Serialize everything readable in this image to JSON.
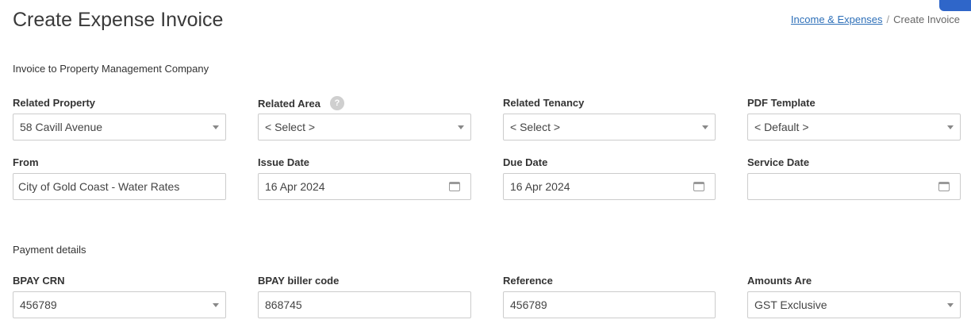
{
  "header": {
    "title": "Create Expense Invoice",
    "breadcrumb": {
      "link": "Income & Expenses",
      "separator": "/",
      "current": "Create Invoice"
    }
  },
  "sections": {
    "invoice_to": "Invoice to Property Management Company",
    "payment": "Payment details"
  },
  "fields": {
    "related_property": {
      "label": "Related Property",
      "value": "58 Cavill Avenue"
    },
    "related_area": {
      "label": "Related Area",
      "value": "< Select >",
      "help": "?"
    },
    "related_tenancy": {
      "label": "Related Tenancy",
      "value": "< Select >"
    },
    "pdf_template": {
      "label": "PDF Template",
      "value": "< Default >"
    },
    "from": {
      "label": "From",
      "value": "City of Gold Coast - Water Rates"
    },
    "issue_date": {
      "label": "Issue Date",
      "value": "16 Apr 2024"
    },
    "due_date": {
      "label": "Due Date",
      "value": "16 Apr 2024"
    },
    "service_date": {
      "label": "Service Date",
      "value": ""
    },
    "bpay_crn": {
      "label": "BPAY CRN",
      "value": "456789"
    },
    "bpay_biller_code": {
      "label": "BPAY biller code",
      "value": "868745"
    },
    "reference": {
      "label": "Reference",
      "value": "456789"
    },
    "amounts_are": {
      "label": "Amounts Are",
      "value": "GST Exclusive"
    }
  },
  "colors": {
    "accent": "#2f66c9",
    "link": "#2d6fb8",
    "border": "#cccccc"
  }
}
